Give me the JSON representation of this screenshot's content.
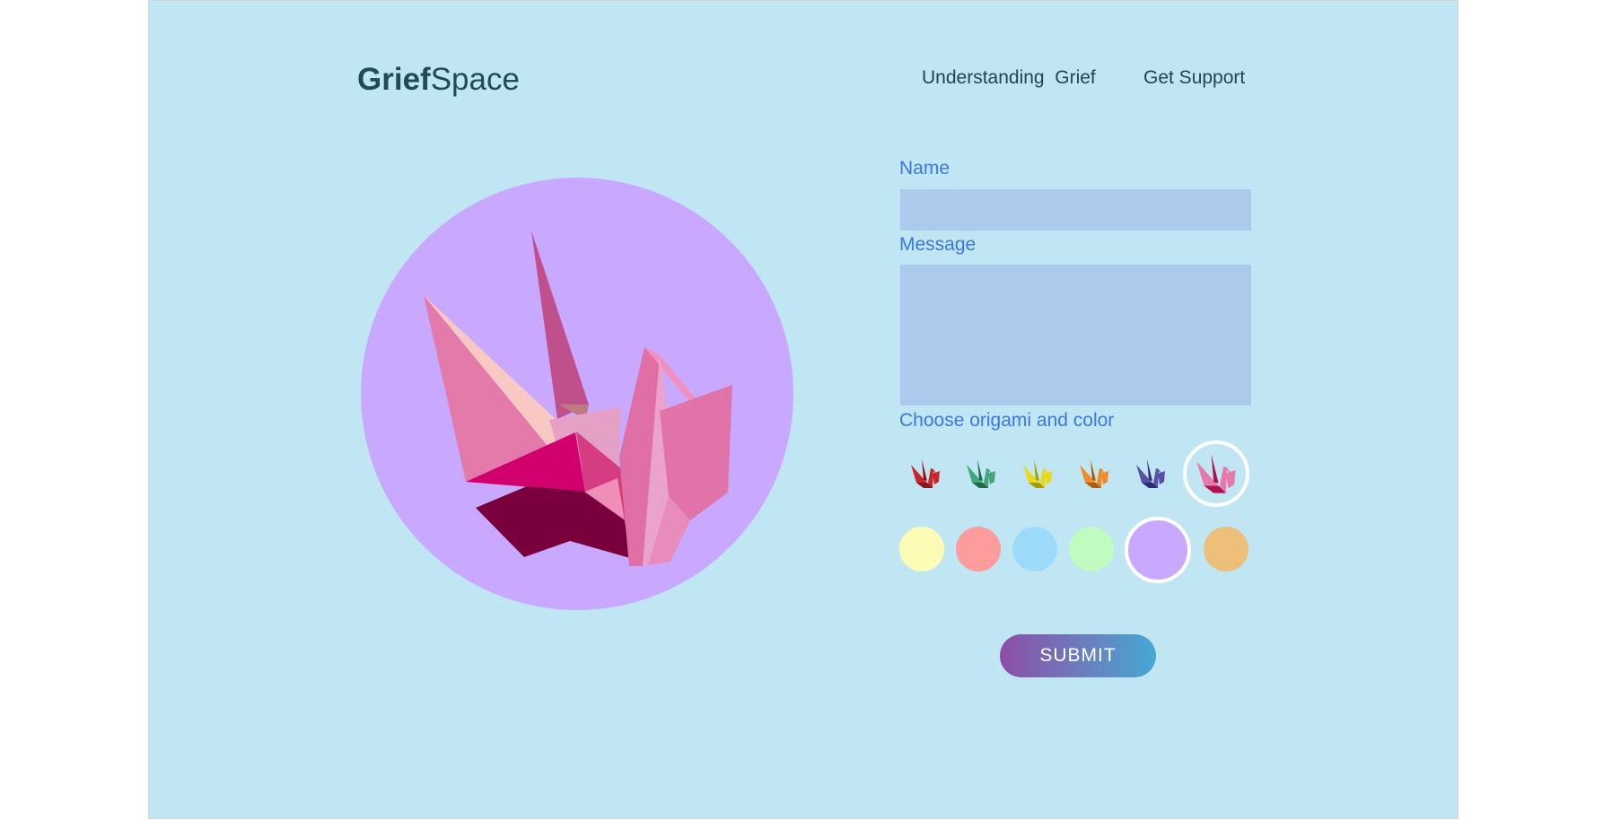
{
  "brand": {
    "part1": "Grief",
    "part2": "Space"
  },
  "nav": [
    {
      "label": "Understanding  Grief"
    },
    {
      "label": "Get Support"
    }
  ],
  "hero": {
    "bg_color": "#c9a8ff",
    "crane_color": "pink",
    "icon": "origami-crane-icon"
  },
  "form": {
    "name_label": "Name",
    "name_value": "",
    "message_label": "Message",
    "message_value": "",
    "choose_label": "Choose origami and color",
    "submit_label": "SUBMIT"
  },
  "cranes": [
    {
      "name": "red",
      "color": "#c8262c",
      "shade": "#8a1319",
      "selected": false
    },
    {
      "name": "green",
      "color": "#45a57a",
      "shade": "#1e6b4a",
      "selected": false
    },
    {
      "name": "yellow",
      "color": "#e8da18",
      "shade": "#a79a05",
      "selected": false
    },
    {
      "name": "orange",
      "color": "#ee8a28",
      "shade": "#b05a0e",
      "selected": false
    },
    {
      "name": "indigo",
      "color": "#5752a6",
      "shade": "#302b74",
      "selected": false
    },
    {
      "name": "pink",
      "color": "#e67aa8",
      "shade": "#b0124f",
      "selected": true
    }
  ],
  "colors": [
    {
      "name": "light-yellow",
      "hex": "#fdfbb5",
      "selected": false
    },
    {
      "name": "salmon",
      "hex": "#fc9c9c",
      "selected": false
    },
    {
      "name": "sky-blue",
      "hex": "#9edaf9",
      "selected": false
    },
    {
      "name": "mint-green",
      "hex": "#c0fcc0",
      "selected": false
    },
    {
      "name": "lavender",
      "hex": "#c9a8ff",
      "selected": true
    },
    {
      "name": "peach",
      "hex": "#eebf78",
      "selected": false
    }
  ]
}
